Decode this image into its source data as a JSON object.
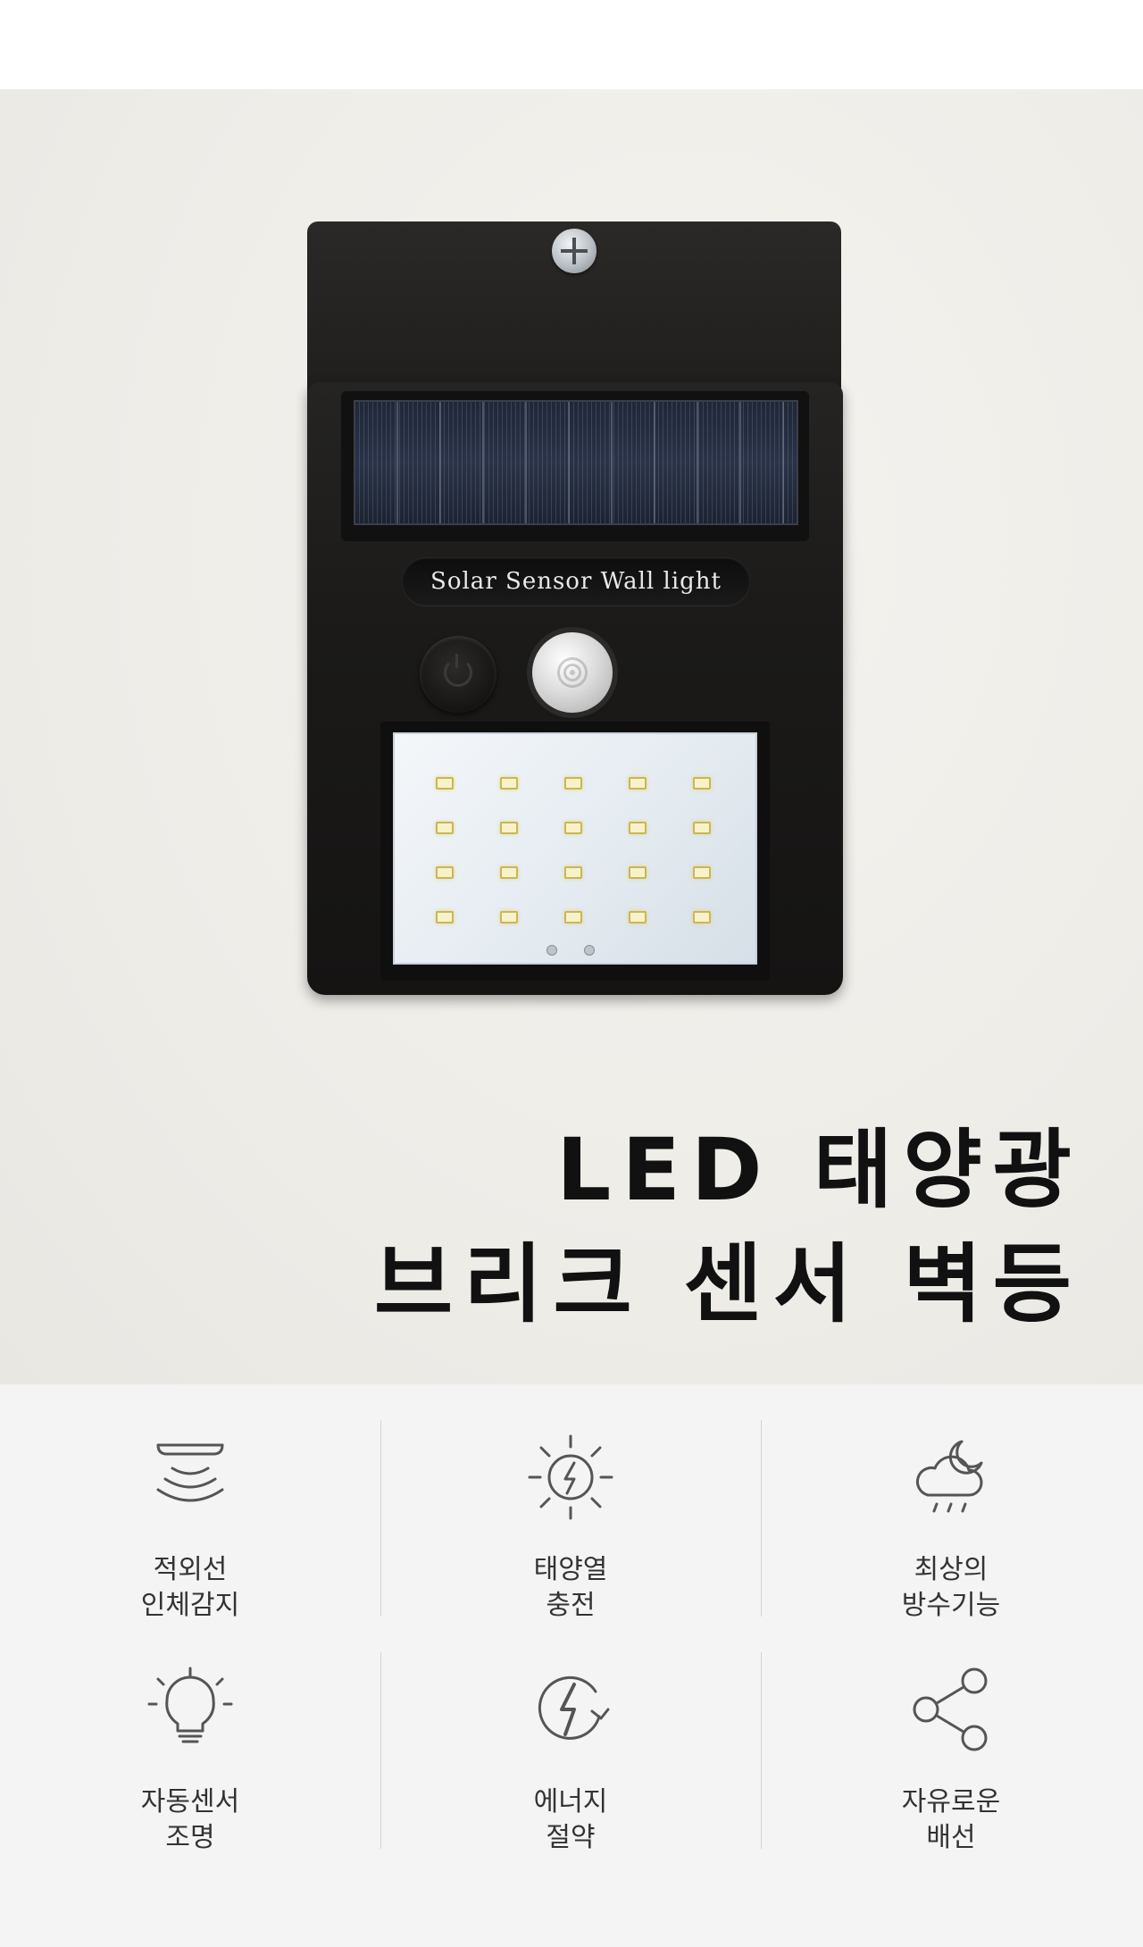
{
  "product": {
    "label_plate_text": "Solar Sensor Wall light",
    "title_line1": "LED 태양광",
    "title_line2": "브리크 센서 벽등"
  },
  "features": [
    {
      "icon": "motion-sensor-icon",
      "line1": "적외선",
      "line2": "인체감지"
    },
    {
      "icon": "solar-charge-icon",
      "line1": "태양열",
      "line2": "충전"
    },
    {
      "icon": "weather-cloud-rain-icon",
      "line1": "최상의",
      "line2": "방수기능"
    },
    {
      "icon": "lightbulb-icon",
      "line1": "자동센서",
      "line2": "조명"
    },
    {
      "icon": "energy-save-icon",
      "line1": "에너지",
      "line2": "절약"
    },
    {
      "icon": "share-wiring-icon",
      "line1": "자유로운",
      "line2": "배선"
    }
  ],
  "colors": {
    "title_text": "#111111",
    "feature_text": "#333333",
    "feature_background": "#f4f4f4",
    "icon_stroke": "#555555"
  }
}
